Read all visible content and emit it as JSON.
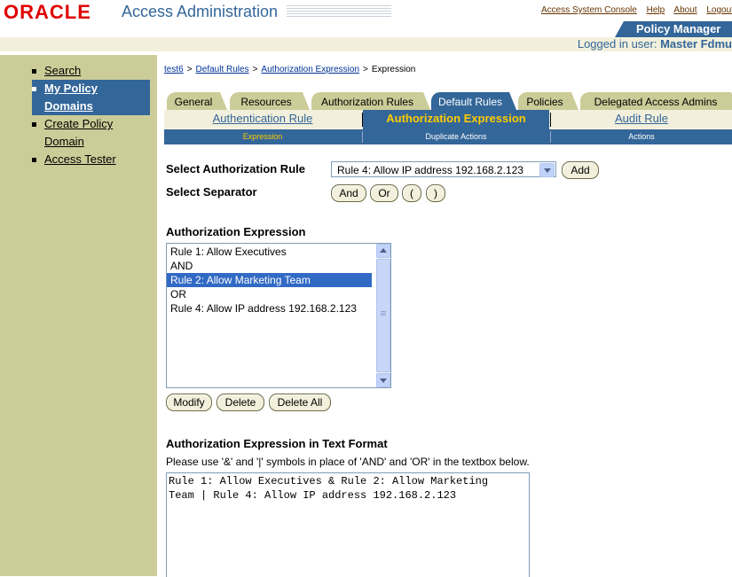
{
  "header": {
    "logo_text": "ORACLE",
    "app_title": "Access Administration",
    "global_links": [
      "Access System Console",
      "Help",
      "About",
      "Logout"
    ],
    "product_tab": "Policy Manager",
    "logged_in_label": "Logged in user:",
    "logged_in_user": "Master Fdmu"
  },
  "sidebar": {
    "items": [
      {
        "label": "Search",
        "active": false
      },
      {
        "label": "My Policy Domains",
        "active": true
      },
      {
        "label": "Create Policy Domain",
        "active": false
      },
      {
        "label": "Access Tester",
        "active": false
      }
    ],
    "item_lines": [
      [
        "Search"
      ],
      [
        "My Policy",
        "Domains"
      ],
      [
        "Create Policy",
        "Domain"
      ],
      [
        "Access Tester"
      ]
    ]
  },
  "breadcrumb": [
    "test6",
    "Default Rules",
    "Authorization Expression",
    "Expression"
  ],
  "tabs": [
    {
      "label": "General",
      "active": false
    },
    {
      "label": "Resources",
      "active": false
    },
    {
      "label": "Authorization Rules",
      "active": false
    },
    {
      "label": "Default Rules",
      "active": true
    },
    {
      "label": "Policies",
      "active": false
    },
    {
      "label": "Delegated Access Admins",
      "active": false
    }
  ],
  "subtabs": [
    {
      "label": "Authentication Rule",
      "active": false
    },
    {
      "label": "Authorization Expression",
      "active": true
    },
    {
      "label": "Audit Rule",
      "active": false
    }
  ],
  "actions": [
    {
      "label": "Expression",
      "active": true
    },
    {
      "label": "Duplicate Actions",
      "active": false
    },
    {
      "label": "Actions",
      "active": false
    }
  ],
  "form": {
    "select_rule_label": "Select Authorization Rule",
    "select_rule_value": "Rule 4: Allow IP address 192.168.2.123",
    "add_button": "Add",
    "select_separator_label": "Select Separator",
    "separators": [
      "And",
      "Or",
      "(",
      ")"
    ],
    "expression_label": "Authorization Expression",
    "expression_items": [
      {
        "text": "Rule 1: Allow Executives",
        "selected": false
      },
      {
        "text": "AND",
        "selected": false
      },
      {
        "text": "Rule 2: Allow Marketing Team",
        "selected": true
      },
      {
        "text": "OR",
        "selected": false
      },
      {
        "text": "Rule 4: Allow IP address 192.168.2.123",
        "selected": false
      }
    ],
    "list_buttons": [
      "Modify",
      "Delete",
      "Delete All"
    ],
    "text_format_label": "Authorization Expression in Text Format",
    "text_format_instructions": "Please use '&' and '|' symbols in place of 'AND' and 'OR' in the textbox below.",
    "text_format_value": "Rule 1: Allow Executives & Rule 2: Allow Marketing\nTeam | Rule 4: Allow IP address 192.168.2.123"
  },
  "colors": {
    "brand_red": "#e00000",
    "primary_blue": "#336699",
    "sidebar_tan": "#cccc99",
    "active_gold": "#ffcc00",
    "selection_blue": "#316ac5"
  }
}
